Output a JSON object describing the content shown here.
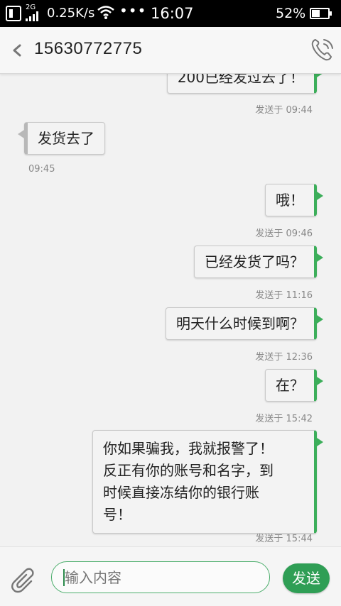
{
  "status_bar": {
    "network_type": "2G",
    "speed": "0.25K/s",
    "more": "•••",
    "time": "16:07",
    "battery_pct": "52%",
    "battery_level": 0.52
  },
  "header": {
    "title": "15630772775",
    "icons": {
      "back": "back-chevron-icon",
      "call": "phone-icon"
    }
  },
  "messages": [
    {
      "dir": "out",
      "text": "200已经发过去了！",
      "meta": "发送于 09:44"
    },
    {
      "dir": "in",
      "text": "发货去了",
      "meta": "09:45"
    },
    {
      "dir": "out",
      "text": "哦！",
      "meta": "发送于 09:46"
    },
    {
      "dir": "out",
      "text": "已经发货了吗？",
      "meta": "发送于 11:16"
    },
    {
      "dir": "out",
      "text": "明天什么时候到啊？",
      "meta": "发送于 12:36"
    },
    {
      "dir": "out",
      "text": "在？",
      "meta": "发送于 15:42"
    },
    {
      "dir": "out",
      "lines": [
        "你如果骗我，我就报警了！",
        "反正有你的账号和名字，到",
        "时候直接冻结你的银行账",
        "号！"
      ],
      "meta": "发送于 15:44"
    }
  ],
  "composer": {
    "placeholder": "输入内容",
    "send_label": "发送",
    "icons": {
      "attach": "paperclip-icon"
    }
  },
  "colors": {
    "accent": "#3cae5a",
    "send_button": "#2f9e55"
  }
}
